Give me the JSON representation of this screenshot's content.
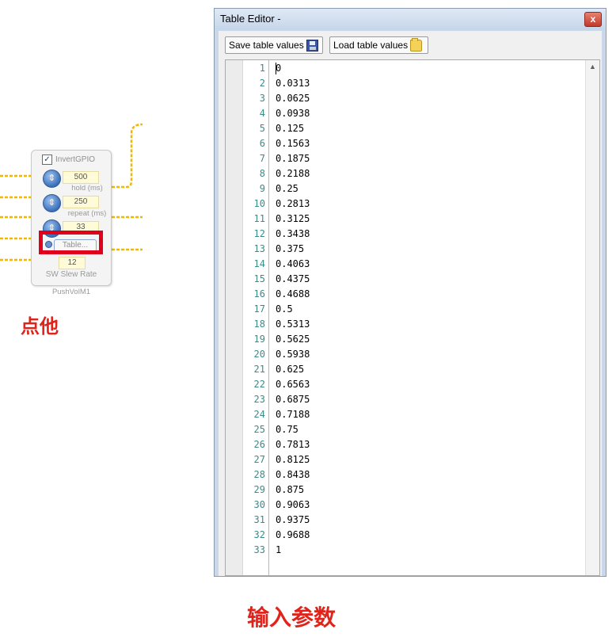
{
  "module": {
    "invert_label": "InvertGPIO",
    "invert_checked": true,
    "hold_value": "500",
    "hold_label": "hold (ms)",
    "repeat_value": "250",
    "repeat_label": "repeat (ms)",
    "rate_value": "33",
    "table_button_label": "Table...",
    "slew_value": "12",
    "slew_label": "SW Slew Rate",
    "name": "PushVolM1"
  },
  "captions": {
    "click_it": "点他",
    "enter_params": "输入参数"
  },
  "window": {
    "title": "Table Editor -",
    "close_glyph": "x",
    "save_label": "Save table values",
    "load_label": "Load table values",
    "scroll_up_glyph": "▲"
  },
  "table_lines": [
    {
      "n": "1",
      "v": "0"
    },
    {
      "n": "2",
      "v": "0.0313"
    },
    {
      "n": "3",
      "v": "0.0625"
    },
    {
      "n": "4",
      "v": "0.0938"
    },
    {
      "n": "5",
      "v": "0.125"
    },
    {
      "n": "6",
      "v": "0.1563"
    },
    {
      "n": "7",
      "v": "0.1875"
    },
    {
      "n": "8",
      "v": "0.2188"
    },
    {
      "n": "9",
      "v": "0.25"
    },
    {
      "n": "10",
      "v": "0.2813"
    },
    {
      "n": "11",
      "v": "0.3125"
    },
    {
      "n": "12",
      "v": "0.3438"
    },
    {
      "n": "13",
      "v": "0.375"
    },
    {
      "n": "14",
      "v": "0.4063"
    },
    {
      "n": "15",
      "v": "0.4375"
    },
    {
      "n": "16",
      "v": "0.4688"
    },
    {
      "n": "17",
      "v": "0.5"
    },
    {
      "n": "18",
      "v": "0.5313"
    },
    {
      "n": "19",
      "v": "0.5625"
    },
    {
      "n": "20",
      "v": "0.5938"
    },
    {
      "n": "21",
      "v": "0.625"
    },
    {
      "n": "22",
      "v": "0.6563"
    },
    {
      "n": "23",
      "v": "0.6875"
    },
    {
      "n": "24",
      "v": "0.7188"
    },
    {
      "n": "25",
      "v": "0.75"
    },
    {
      "n": "26",
      "v": "0.7813"
    },
    {
      "n": "27",
      "v": "0.8125"
    },
    {
      "n": "28",
      "v": "0.8438"
    },
    {
      "n": "29",
      "v": "0.875"
    },
    {
      "n": "30",
      "v": "0.9063"
    },
    {
      "n": "31",
      "v": "0.9375"
    },
    {
      "n": "32",
      "v": "0.9688"
    },
    {
      "n": "33",
      "v": "1"
    }
  ],
  "colors": {
    "wire": "#f2b800",
    "annotation_red": "#e0001b",
    "line_number": "#3a8a8a"
  }
}
